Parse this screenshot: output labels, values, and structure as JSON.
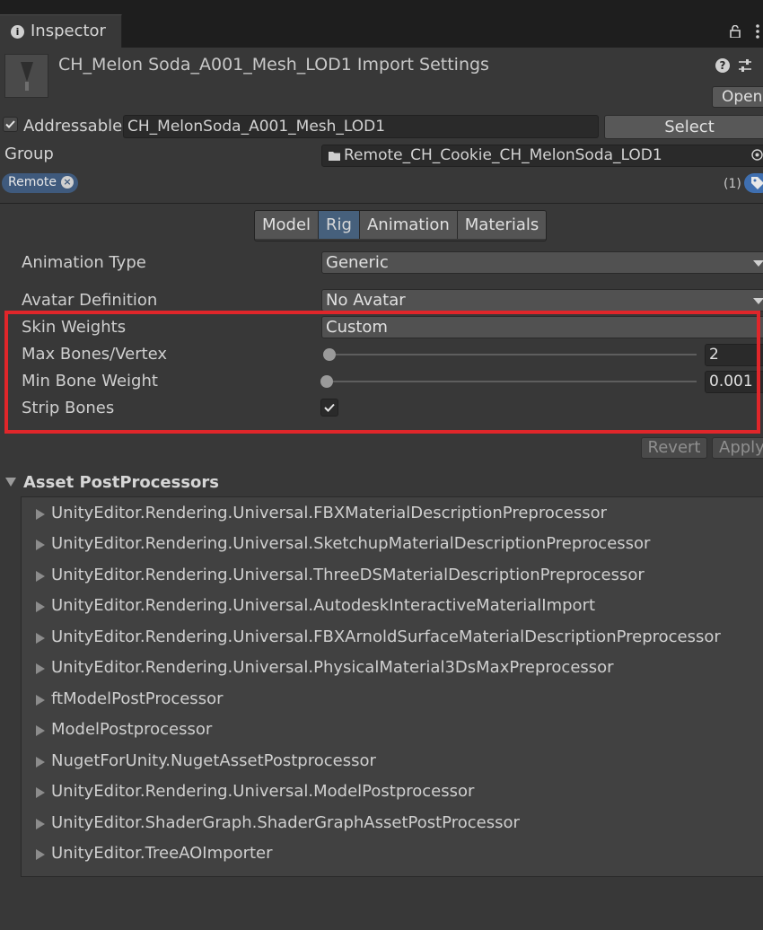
{
  "tab": {
    "label": "Inspector"
  },
  "header": {
    "title": "CH_Melon Soda_A001_Mesh_LOD1 Import Settings",
    "open_label": "Open"
  },
  "addressable": {
    "label": "Addressable",
    "checked": true,
    "value": "CH_MelonSoda_A001_Mesh_LOD1",
    "select_label": "Select"
  },
  "group": {
    "label": "Group",
    "value": "Remote_CH_Cookie_CH_MelonSoda_LOD1"
  },
  "labels": {
    "tag": "Remote",
    "count": "(1)"
  },
  "tabs": [
    {
      "label": "Model"
    },
    {
      "label": "Rig"
    },
    {
      "label": "Animation"
    },
    {
      "label": "Materials"
    }
  ],
  "rig": {
    "animation_type": {
      "label": "Animation Type",
      "value": "Generic"
    },
    "avatar_definition": {
      "label": "Avatar Definition",
      "value": "No Avatar"
    },
    "skin_weights": {
      "label": "Skin Weights",
      "value": "Custom"
    },
    "max_bones": {
      "label": "Max Bones/Vertex",
      "value": "2"
    },
    "min_bone_weight": {
      "label": "Min Bone Weight",
      "value": "0.001"
    },
    "strip_bones": {
      "label": "Strip Bones",
      "checked": true
    }
  },
  "actions": {
    "revert": "Revert",
    "apply": "Apply"
  },
  "postprocessors": {
    "title": "Asset PostProcessors",
    "items": [
      "UnityEditor.Rendering.Universal.FBXMaterialDescriptionPreprocessor",
      "UnityEditor.Rendering.Universal.SketchupMaterialDescriptionPreprocessor",
      "UnityEditor.Rendering.Universal.ThreeDSMaterialDescriptionPreprocessor",
      "UnityEditor.Rendering.Universal.AutodeskInteractiveMaterialImport",
      "UnityEditor.Rendering.Universal.FBXArnoldSurfaceMaterialDescriptionPreprocessor",
      "UnityEditor.Rendering.Universal.PhysicalMaterial3DsMaxPreprocessor",
      "ftModelPostProcessor",
      "ModelPostprocessor",
      "NugetForUnity.NugetAssetPostprocessor",
      "UnityEditor.Rendering.Universal.ModelPostprocessor",
      "UnityEditor.ShaderGraph.ShaderGraphAssetPostProcessor",
      "UnityEditor.TreeAOImporter"
    ]
  },
  "colors": {
    "background": "#383838",
    "highlight": "#e0262a",
    "active_tab": "#46607c",
    "tag": "#3f5a7d"
  }
}
